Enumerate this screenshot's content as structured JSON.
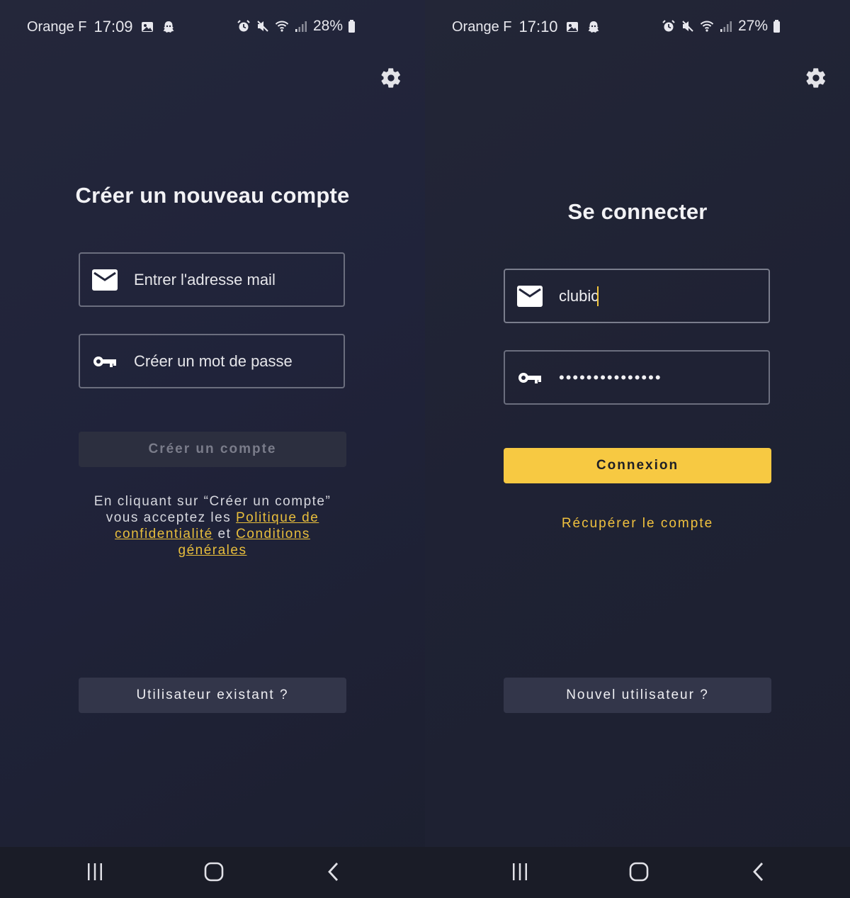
{
  "left": {
    "status": {
      "carrier": "Orange F",
      "time": "17:09",
      "battery": "28%"
    },
    "title": "Créer un nouveau compte",
    "email_placeholder": "Entrer l'adresse mail",
    "password_placeholder": "Créer un mot de passe",
    "create_button": "Créer un compte",
    "terms": {
      "line1": "En cliquant sur “Créer un compte”",
      "line2": "vous acceptez les ",
      "privacy_link": "Politique de confidentialité",
      "and": " et ",
      "conditions_link": "Conditions générales"
    },
    "existing_user_button": "Utilisateur existant ?"
  },
  "right": {
    "status": {
      "carrier": "Orange F",
      "time": "17:10",
      "battery": "27%"
    },
    "title": "Se connecter",
    "email_value": "clubic",
    "password_dots": "•••••••••••••••",
    "login_button": "Connexion",
    "recover_link": "Récupérer le compte",
    "new_user_button": "Nouvel utilisateur ?"
  },
  "icons": {
    "settings": "gear-icon",
    "email": "envelope-icon",
    "password": "key-icon",
    "status": [
      "gallery-icon",
      "snapchat-icon",
      "alarm-icon",
      "mute-icon",
      "wifi-icon",
      "signal-icon",
      "battery-icon"
    ],
    "nav": [
      "recent-apps-icon",
      "home-icon",
      "back-icon"
    ]
  },
  "colors": {
    "background": "#22253a",
    "accent_yellow": "#f7c942",
    "link_yellow": "#e8be3c",
    "secondary_button": "#33364a"
  }
}
